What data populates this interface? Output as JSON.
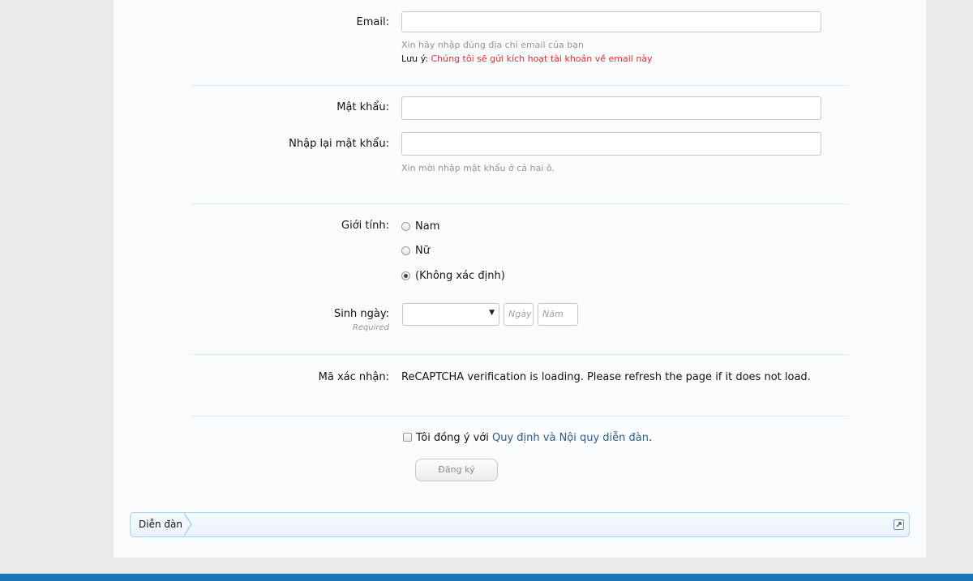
{
  "form": {
    "email": {
      "label": "Email:",
      "value": "",
      "hint": "Xin hãy nhập đúng địa chỉ email của bạn",
      "note_label": "Lưu ý:",
      "note_text": "Chúng tôi sẽ gửi kích hoạt tài khoản về email này"
    },
    "password": {
      "label": "Mật khẩu:",
      "value": ""
    },
    "password_confirm": {
      "label": "Nhập lại mật khẩu:",
      "value": "",
      "hint": "Xin mời nhập mật khẩu ở cả hai ô."
    },
    "gender": {
      "label": "Giới tính:",
      "options": [
        {
          "label": "Nam",
          "checked": false
        },
        {
          "label": "Nữ",
          "checked": false
        },
        {
          "label": "(Không xác định)",
          "checked": true
        }
      ]
    },
    "birthday": {
      "label": "Sinh ngày:",
      "required": "Required",
      "month_value": "",
      "day_placeholder": "Ngày",
      "year_placeholder": "Năm"
    },
    "captcha": {
      "label": "Mã xác nhận:",
      "text": "ReCAPTCHA verification is loading. Please refresh the page if it does not load."
    },
    "agree": {
      "prefix": "Tôi đồng ý với",
      "link_text": "Quy định và Nội quy diễn đàn",
      "suffix": ".",
      "checked": false
    },
    "submit_label": "Đăng ký"
  },
  "breadcrumb": {
    "items": [
      "Diễn đàn"
    ]
  },
  "colors": {
    "accent": "#1a75bb",
    "link": "#2a5d92",
    "warning": "#e03030"
  }
}
